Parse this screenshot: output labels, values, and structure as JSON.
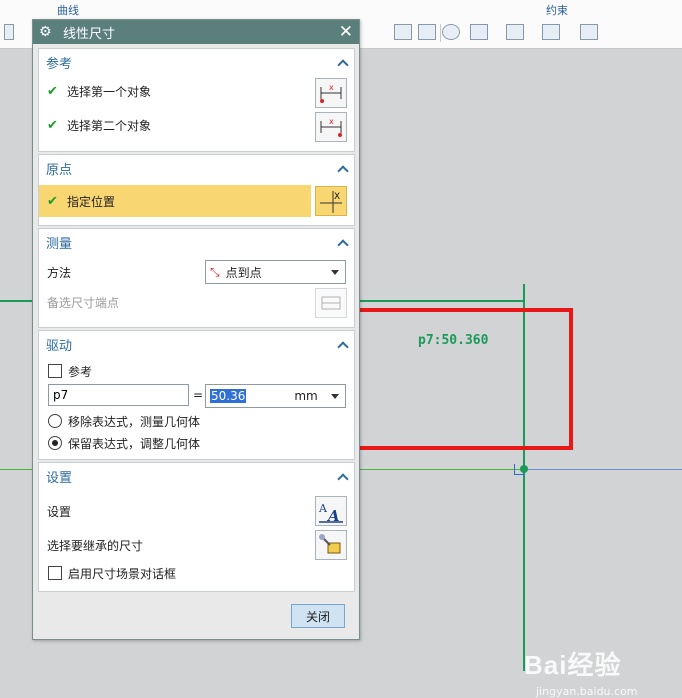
{
  "ribbon": {
    "group_curve": "曲线",
    "group_constraint": "约束"
  },
  "dialog": {
    "title": "线性尺寸",
    "close_symbol": "✕",
    "sections": {
      "reference": {
        "title": "参考",
        "first_object": "选择第一个对象",
        "second_object": "选择第二个对象"
      },
      "origin": {
        "title": "原点",
        "specify_location": "指定位置"
      },
      "measure": {
        "title": "测量",
        "method_label": "方法",
        "method_value": "点到点",
        "alt_endpoint": "备选尺寸端点"
      },
      "driving": {
        "title": "驱动",
        "reference_checkbox": "参考",
        "reference_checked": false,
        "name_value": "p7",
        "equals": "=",
        "value": "50.36",
        "unit": "mm",
        "option_remove": "移除表达式，测量几何体",
        "option_keep": "保留表达式，调整几何体",
        "selected_option": "option_keep"
      },
      "settings": {
        "title": "设置",
        "settings_label": "设置",
        "inherit_label": "选择要继承的尺寸",
        "enable_scene_dialog": "启用尺寸场景对话框",
        "enable_scene_checked": false
      }
    },
    "close_button": "关闭"
  },
  "canvas": {
    "dimension_label": "p7:50.360",
    "line_color": "#1b9a5a",
    "highlight_color": "#e81818"
  },
  "watermark": {
    "brand": "Bai经验",
    "url": "jingyan.baidu.com"
  }
}
